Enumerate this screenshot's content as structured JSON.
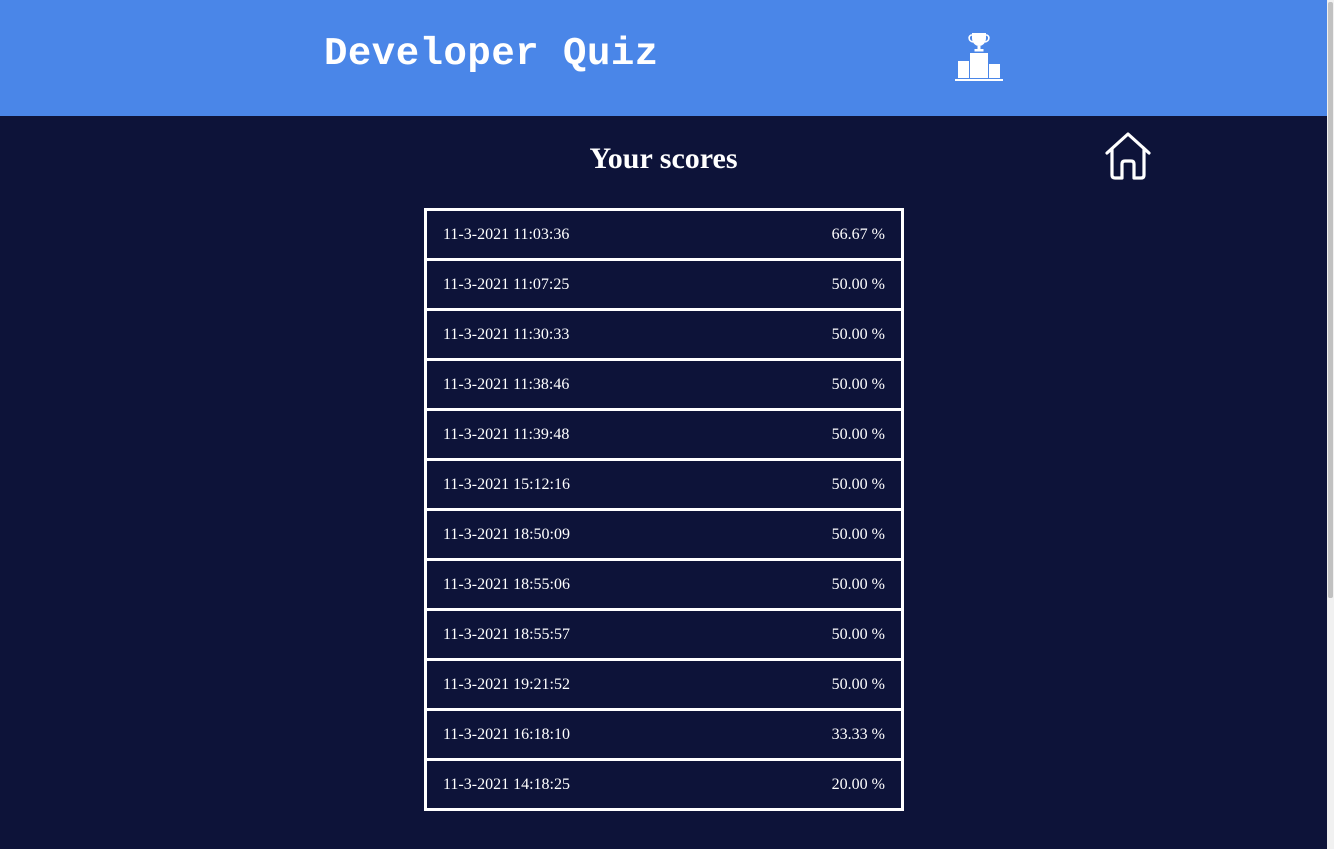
{
  "header": {
    "app_title": "Developer Quiz",
    "leaderboard_icon": "podium-trophy-icon"
  },
  "nav": {
    "home_icon": "home-icon"
  },
  "main": {
    "page_title": "Your scores",
    "scores": [
      {
        "datetime": "11-3-2021 11:03:36",
        "score": "66.67 %"
      },
      {
        "datetime": "11-3-2021 11:07:25",
        "score": "50.00 %"
      },
      {
        "datetime": "11-3-2021 11:30:33",
        "score": "50.00 %"
      },
      {
        "datetime": "11-3-2021 11:38:46",
        "score": "50.00 %"
      },
      {
        "datetime": "11-3-2021 11:39:48",
        "score": "50.00 %"
      },
      {
        "datetime": "11-3-2021 15:12:16",
        "score": "50.00 %"
      },
      {
        "datetime": "11-3-2021 18:50:09",
        "score": "50.00 %"
      },
      {
        "datetime": "11-3-2021 18:55:06",
        "score": "50.00 %"
      },
      {
        "datetime": "11-3-2021 18:55:57",
        "score": "50.00 %"
      },
      {
        "datetime": "11-3-2021 19:21:52",
        "score": "50.00 %"
      },
      {
        "datetime": "11-3-2021 16:18:10",
        "score": "33.33 %"
      },
      {
        "datetime": "11-3-2021 14:18:25",
        "score": "20.00 %"
      }
    ]
  },
  "colors": {
    "header_background": "#4a86e8",
    "page_background": "#0d1339",
    "text": "#ffffff",
    "row_border": "#ffffff"
  }
}
